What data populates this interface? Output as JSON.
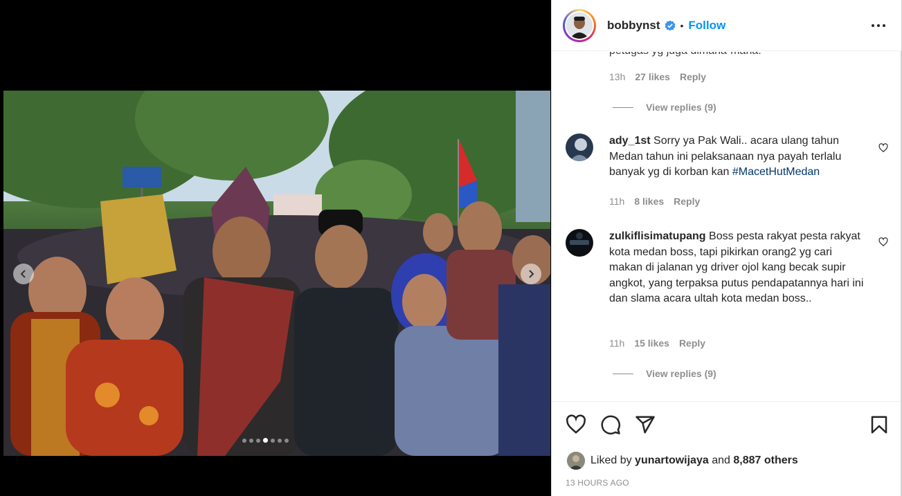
{
  "post": {
    "username": "bobbynst",
    "verified": true,
    "separator": "•",
    "follow_label": "Follow",
    "more_icon": "more-options-icon",
    "carousel": {
      "slide_count": 7,
      "active_index": 3
    }
  },
  "comments": {
    "cut_off_text": "petugas yg juga dimana-mana.",
    "first_meta": {
      "time": "13h",
      "likes": "27 likes",
      "reply": "Reply"
    },
    "first_view_replies": "View replies (9)",
    "items": [
      {
        "username": "ady_1st",
        "text": "Sorry ya Pak Wali.. acara ulang tahun Medan tahun ini pelaksanaan nya payah terlalu banyak yg di korban kan ",
        "hashtag": "#MacetHutMedan",
        "time": "11h",
        "likes": "8 likes",
        "reply": "Reply"
      },
      {
        "username": "zulkiflisimatupang",
        "text": "Boss pesta rakyat pesta rakyat kota medan boss, tapi pikirkan orang2 yg cari makan di jalanan yg driver ojol kang becak supir angkot, yang terpaksa putus pendapatannya hari ini dan slama acara ultah kota medan boss..",
        "time": "11h",
        "likes": "15 likes",
        "reply": "Reply",
        "view_replies": "View replies (9)"
      }
    ]
  },
  "actions": {
    "like_icon": "heart-icon",
    "comment_icon": "comment-icon",
    "share_icon": "paper-plane-icon",
    "save_icon": "bookmark-icon"
  },
  "likes": {
    "prefix": "Liked by",
    "user": "yunartowijaya",
    "and": "and",
    "others": "8,887 others"
  },
  "timestamp": "13 HOURS AGO",
  "colors": {
    "link_blue": "#0095f6",
    "hashtag_blue": "#00376b",
    "muted_gray": "#8e8e8e",
    "text_dark": "#262626"
  }
}
